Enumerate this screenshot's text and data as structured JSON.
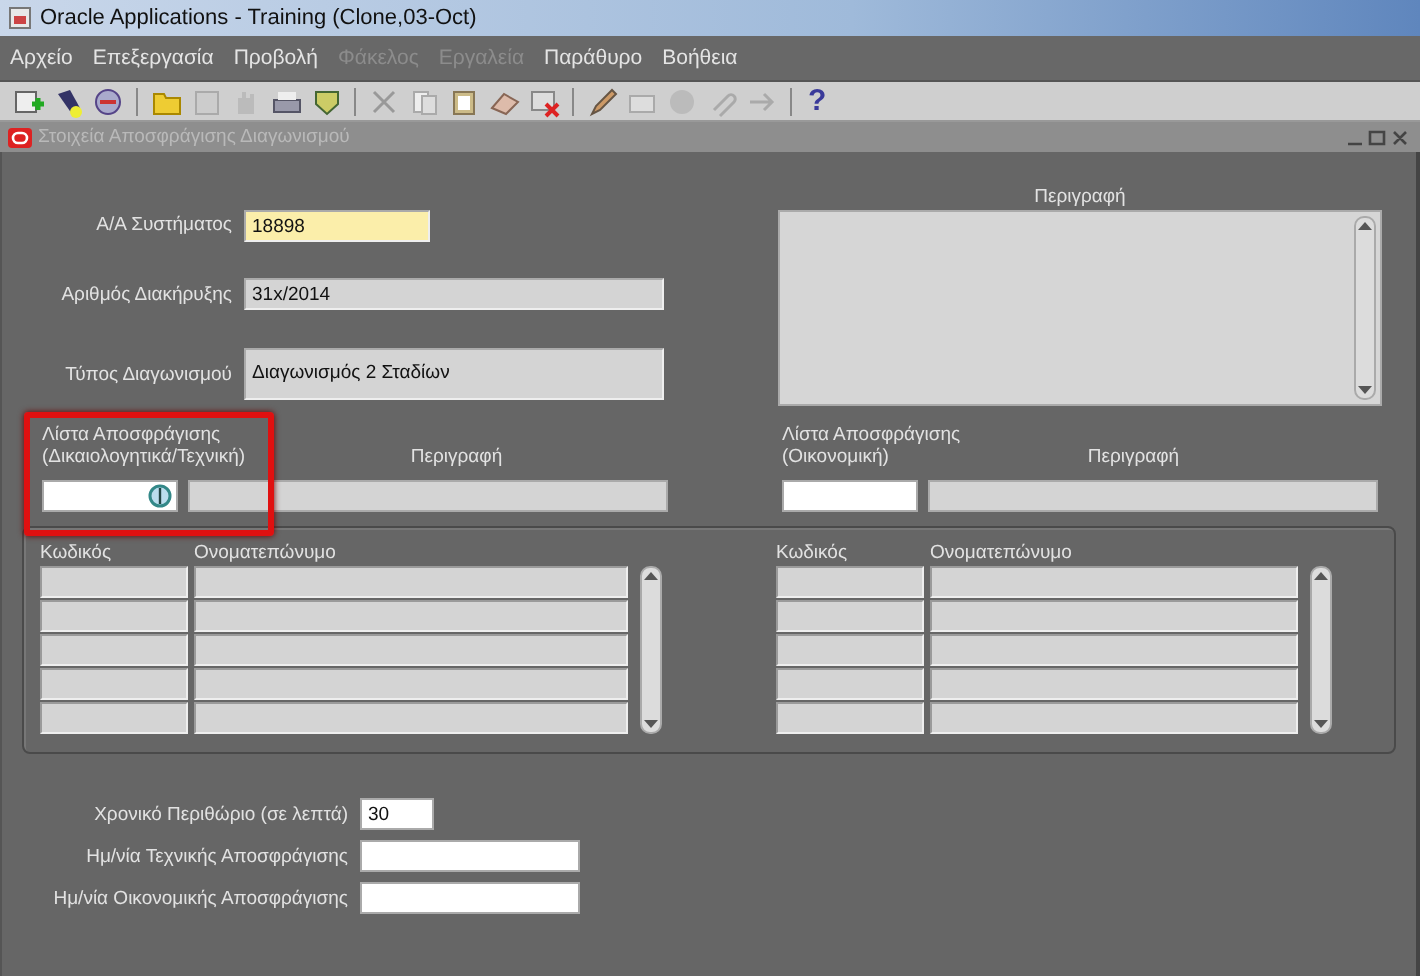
{
  "window": {
    "title": "Oracle Applications - Training (Clone,03-Oct)"
  },
  "menu": [
    {
      "label": "Αρχείο",
      "disabled": false
    },
    {
      "label": "Επεξεργασία",
      "disabled": false
    },
    {
      "label": "Προβολή",
      "disabled": false
    },
    {
      "label": "Φάκελος",
      "disabled": true
    },
    {
      "label": "Εργαλεία",
      "disabled": true
    },
    {
      "label": "Παράθυρο",
      "disabled": false
    },
    {
      "label": "Βοήθεια",
      "disabled": false
    }
  ],
  "toolbar": {
    "help": "?"
  },
  "form": {
    "title": "Στοιχεία Αποσφράγισης Διαγωνισμού",
    "header_fields": [
      {
        "label": "Α/Α Συστήματος",
        "value": "18898",
        "required": true,
        "read_only": false
      },
      {
        "label": "Αριθμός Διακήρυξης",
        "value": "31x/2014",
        "required": false,
        "read_only": true
      },
      {
        "label": "Τύπος Διαγωνισμού",
        "value": "Διαγωνισμός 2 Σταδίων",
        "required": false,
        "read_only": true
      }
    ],
    "description": {
      "label": "Περιγραφή"
    },
    "lists": [
      {
        "label": "Λίστα Αποσφράγισης",
        "sublabel": "(Δικαιολογητικά/Τεχνική)",
        "description_label": "Περιγραφή",
        "highlighted": true,
        "lov_icon": true
      },
      {
        "label": "Λίστα Αποσφράγισης",
        "sublabel": "(Οικονομική)",
        "description_label": "Περιγραφή",
        "highlighted": false,
        "lov_icon": false
      }
    ],
    "tables": [
      {
        "columns": [
          "Κωδικός",
          "Ονοματεπώνυμο"
        ]
      },
      {
        "columns": [
          "Κωδικός",
          "Ονοματεπώνυμο"
        ]
      }
    ],
    "footer_fields": [
      {
        "label": "Χρονικό Περιθώριο (σε λεπτά)",
        "value": "30"
      },
      {
        "label": "Ημ/νία Τεχνικής Αποσφράγισης"
      },
      {
        "label": "Ημ/νία Οικονομικής Αποσφράγισης"
      }
    ]
  }
}
